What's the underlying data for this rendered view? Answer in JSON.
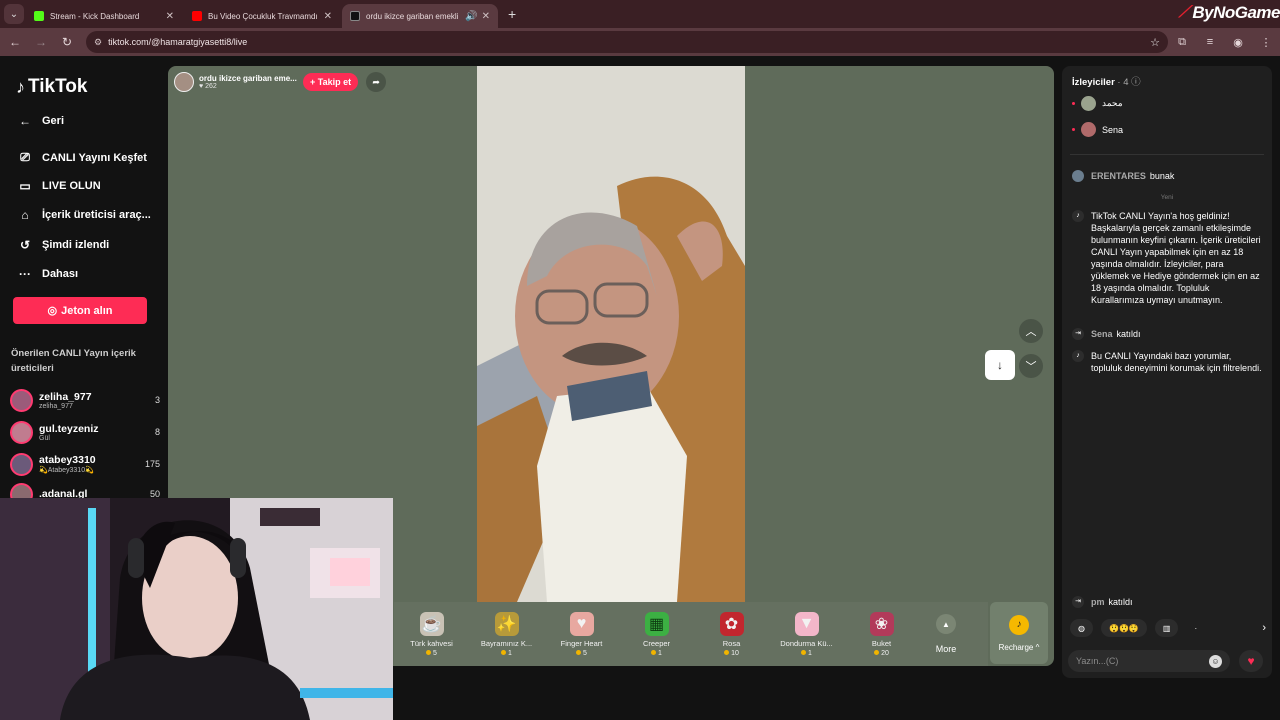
{
  "browser": {
    "tabs": [
      {
        "title": "Stream - Kick Dashboard",
        "color": "#53fc18"
      },
      {
        "title": "Bu Video Çocukluk Travmamdı",
        "color": "#ff0000"
      },
      {
        "title": "ordu ikizce gariban emekli",
        "color": "#111111"
      }
    ],
    "url": "tiktok.com/@hamaratgiyasetti8/live",
    "brand": "ByNoGame"
  },
  "sidebar": {
    "logo": "TikTok",
    "nav": [
      {
        "label": "Geri",
        "icon": "back-arrow-icon",
        "glyph": "←"
      },
      {
        "label": "CANLI Yayını Keşfet",
        "icon": "live-tv-icon",
        "glyph": "📺"
      },
      {
        "label": "LIVE OLUN",
        "icon": "camera-icon",
        "glyph": "▭"
      },
      {
        "label": "İçerik üreticisi araç...",
        "icon": "home-creator-icon",
        "glyph": "⌂"
      },
      {
        "label": "Şimdi izlendi",
        "icon": "history-icon",
        "glyph": "↺"
      },
      {
        "label": "Dahası",
        "icon": "more-dots-icon",
        "glyph": "···"
      }
    ],
    "coins_label": "Jeton alın",
    "suggested_title": "Önerilen CANLI Yayın içerik üreticileri",
    "creators": [
      {
        "name": "zeliha_977",
        "sub": "zeliha_977",
        "count": "3"
      },
      {
        "name": "gul.teyzeniz",
        "sub": "Gül",
        "count": "8"
      },
      {
        "name": "atabey3310",
        "sub": "💫Atabey3310💫",
        "count": "175"
      },
      {
        "name": ".adanal.gl",
        "sub": "",
        "count": "50"
      }
    ]
  },
  "player": {
    "host_name": "ordu ikizce gariban eme...",
    "host_likes": "♥ 262",
    "follow_label": "+ Takip et",
    "gifts": [
      {
        "name": "Türk kahvesi",
        "price": "5",
        "glyph": "☕",
        "bg": "#c9c2b5"
      },
      {
        "name": "Bayramınız K...",
        "price": "1",
        "glyph": "✨",
        "bg": "#b79a3a"
      },
      {
        "name": "Finger Heart",
        "price": "5",
        "glyph": "🫰",
        "bg": "#e8a8a0"
      },
      {
        "name": "Creeper",
        "price": "1",
        "glyph": "▦",
        "bg": "#3cb043"
      },
      {
        "name": "Rosa",
        "price": "10",
        "glyph": "🌹",
        "bg": "#c2262e"
      },
      {
        "name": "Dondurma Kü...",
        "price": "1",
        "glyph": "🍦",
        "bg": "#f3b6c9"
      },
      {
        "name": "Buket",
        "price": "20",
        "glyph": "💐",
        "bg": "#b23a5a"
      }
    ],
    "more_label": "More",
    "recharge_label": "Recharge ^"
  },
  "chat": {
    "viewers_label": "İzleyiciler",
    "viewers_count": "· 4",
    "viewer_list": [
      "محمد",
      "Sena"
    ],
    "first_msg_nick": "ERENTARES",
    "first_msg_text": "bunak",
    "new_label": "Yeni",
    "welcome": "TikTok CANLI Yayın'a hoş geldiniz! Başkalarıyla gerçek zamanlı etkileşimde bulunmanın keyfini çıkarın. İçerik üreticileri CANLI Yayın yapabilmek için en az 18 yaşında olmalıdır. İzleyiciler, para yüklemek ve Hediye göndermek için en az 18 yaşında olmalıdır. Topluluk Kurallarımıza uymayı unutmayın.",
    "join1_nick": "Sena",
    "join1_text": "katıldı",
    "filter_msg": "Bu CANLI Yayındaki bazı yorumlar, topluluk deneyimini korumak için filtrelendi.",
    "join2_nick": "pm",
    "join2_text": "katıldı",
    "input_placeholder": "Yazın...(C)"
  }
}
